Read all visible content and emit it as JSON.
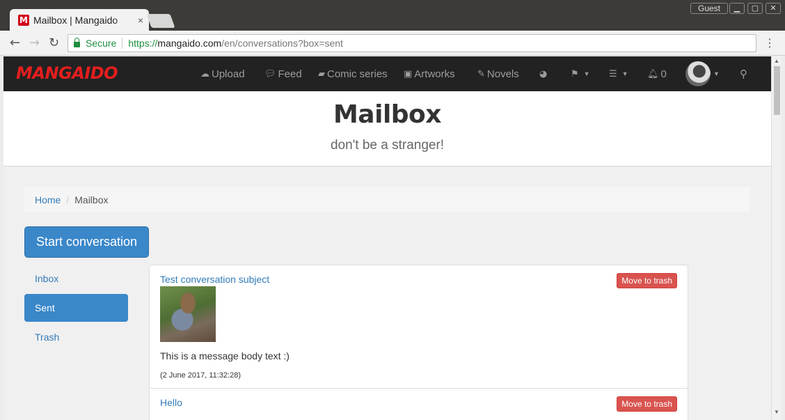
{
  "browser": {
    "tab_title": "Mailbox | Mangaido",
    "tab_close": "×",
    "guest_label": "Guest",
    "secure_label": "Secure",
    "url_scheme": "https://",
    "url_host": "mangaido.com",
    "url_path": "/en/conversations?box=sent"
  },
  "navbar": {
    "brand": "MANGAIDO",
    "items": [
      {
        "icon": "upload-icon",
        "label": "Upload"
      },
      {
        "icon": "comments-icon",
        "label": "Feed"
      },
      {
        "icon": "book-icon",
        "label": "Comic series"
      },
      {
        "icon": "picture-icon",
        "label": "Artworks"
      },
      {
        "icon": "edit-icon",
        "label": "Novels"
      }
    ],
    "notifications_count": "0"
  },
  "header": {
    "title": "Mailbox",
    "subtitle": "don't be a stranger!"
  },
  "breadcrumb": {
    "home": "Home",
    "separator": "/",
    "current": "Mailbox"
  },
  "sidebar": {
    "start_button": "Start conversation",
    "items": [
      {
        "label": "Inbox",
        "active": false
      },
      {
        "label": "Sent",
        "active": true
      },
      {
        "label": "Trash",
        "active": false
      }
    ]
  },
  "messages": [
    {
      "subject": "Test conversation subject",
      "trash_label": "Move to trash",
      "body": "This is a message body text :)",
      "date": "(2 June 2017, 11:32:28)"
    },
    {
      "subject": "Hello",
      "trash_label": "Move to trash"
    }
  ],
  "colors": {
    "brand": "#e41e1e",
    "primary": "#3a87c9",
    "danger": "#d9534f",
    "navbar": "#222222"
  }
}
